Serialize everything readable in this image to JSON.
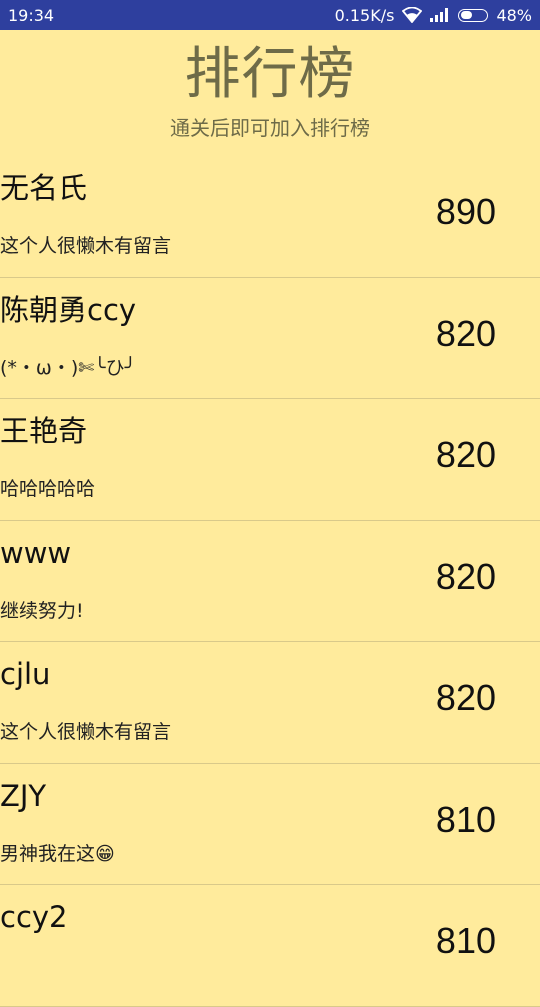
{
  "status_bar": {
    "time": "19:34",
    "network_speed": "0.15K/s",
    "battery": "48%",
    "icons": [
      "wifi-icon",
      "signal-icon",
      "battery-icon"
    ]
  },
  "header": {
    "title": "排行榜",
    "subtitle": "通关后即可加入排行榜"
  },
  "leaderboard": [
    {
      "name": "无名氏",
      "message": "这个人很懒木有留言",
      "score": "890"
    },
    {
      "name": "陈朝勇ccy",
      "message": "(*・ω・)✄╰ひ╯",
      "score": "820"
    },
    {
      "name": "王艳奇",
      "message": "哈哈哈哈哈",
      "score": "820"
    },
    {
      "name": "www",
      "message": "继续努力!",
      "score": "820"
    },
    {
      "name": "cjlu",
      "message": "这个人很懒木有留言",
      "score": "820"
    },
    {
      "name": "ZJY",
      "message": "男神我在这😁",
      "score": "810"
    },
    {
      "name": "ccy2",
      "message": "",
      "score": "810"
    }
  ],
  "colors": {
    "background": "#ffeb9c",
    "status_bar": "#2e3f9e",
    "title": "#6e6b48"
  }
}
